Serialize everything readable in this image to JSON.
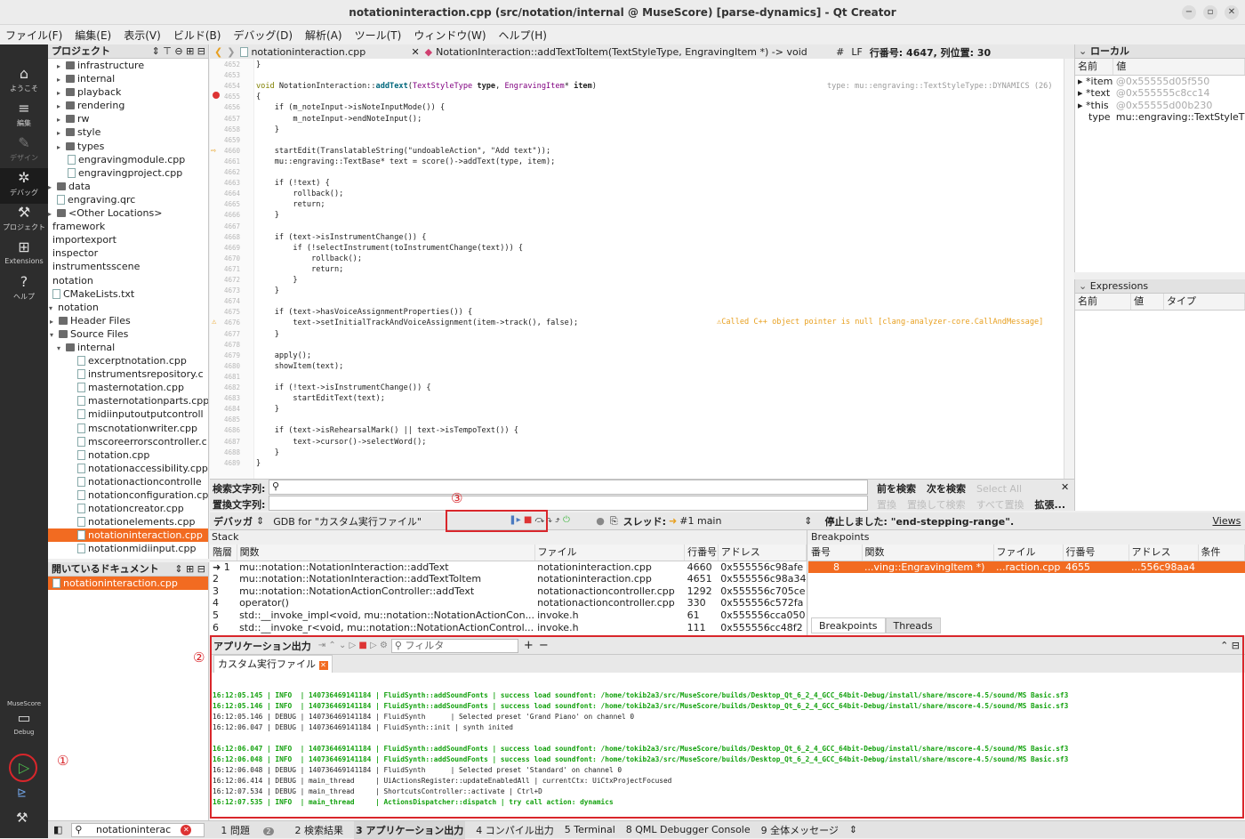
{
  "window": {
    "title": "notationinteraction.cpp (src/notation/internal @ MuseScore) [parse-dynamics] - Qt Creator"
  },
  "menu": [
    "ファイル(F)",
    "編集(E)",
    "表示(V)",
    "ビルド(B)",
    "デバッグ(D)",
    "解析(A)",
    "ツール(T)",
    "ウィンドウ(W)",
    "ヘルプ(H)"
  ],
  "modes": [
    {
      "label": "ようこそ",
      "icon": "home-icon"
    },
    {
      "label": "編集",
      "icon": "edit-icon"
    },
    {
      "label": "デザイン",
      "icon": "design-icon"
    },
    {
      "label": "デバッグ",
      "icon": "bug-icon"
    },
    {
      "label": "プロジェクト",
      "icon": "wrench-icon"
    },
    {
      "label": "Extensions",
      "icon": "extensions-icon"
    },
    {
      "label": "ヘルプ",
      "icon": "help-icon"
    }
  ],
  "kit": {
    "project": "MuseScore",
    "config": "Debug"
  },
  "project_panel": {
    "title": "プロジェクト",
    "items": [
      "infrastructure",
      "internal",
      "playback",
      "rendering",
      "rw",
      "style",
      "types",
      "engravingmodule.cpp",
      "engravingproject.cpp",
      "data",
      "engraving.qrc",
      "<Other Locations>",
      "framework",
      "importexport",
      "inspector",
      "instrumentsscene",
      "notation",
      "CMakeLists.txt",
      "notation",
      "Header Files",
      "Source Files",
      "internal",
      "excerptnotation.cpp",
      "instrumentsrepository.c",
      "masternotation.cpp",
      "masternotationparts.cpp",
      "midiinputoutputcontroll",
      "mscnotationwriter.cpp",
      "mscoreerrorscontroller.c",
      "notation.cpp",
      "notationaccessibility.cpp",
      "notationactioncontrolle",
      "notationconfiguration.cp",
      "notationcreator.cpp",
      "notationelements.cpp",
      "notationinteraction.cpp",
      "notationmidiinput.cpp"
    ]
  },
  "open_docs": {
    "title": "開いているドキュメント",
    "items": [
      "notationinteraction.cpp"
    ]
  },
  "editor": {
    "file_tab": "notationinteraction.cpp",
    "function": "NotationInteraction::addTextToItem(TextStyleType, EngravingItem *) -> void",
    "hash": "#",
    "eol": "LF",
    "line_info": "行番号: 4647, 列位置: 30",
    "first_line": 4652,
    "type_hint": "type: mu::engraving::TextStyleType::DYNAMICS (26)",
    "warning": "Called C++ object pointer is null [clang-analyzer-core.CallAndMessage]"
  },
  "find": {
    "find_label": "検索文字列:",
    "replace_label": "置換文字列:",
    "find_prev": "前を検索",
    "find_next": "次を検索",
    "select_all": "Select All",
    "replace": "置換",
    "replace_find": "置換して検索",
    "replace_all": "すべて置換",
    "advanced": "拡張..."
  },
  "debug_toolbar": {
    "label": "デバッガ",
    "engine": "GDB for \"カスタム実行ファイル\"",
    "thread_label": "スレッド:",
    "thread": "#1 main",
    "stopped": "停止しました: \"end-stepping-range\".",
    "views": "Views"
  },
  "stack": {
    "title": "Stack",
    "headers": [
      "階層",
      "関数",
      "ファイル",
      "行番号",
      "アドレス"
    ],
    "rows": [
      [
        "1",
        "mu::notation::NotationInteraction::addText",
        "notationinteraction.cpp",
        "4660",
        "0x555556c98afe"
      ],
      [
        "2",
        "mu::notation::NotationInteraction::addTextToItem",
        "notationinteraction.cpp",
        "4651",
        "0x555556c98a34"
      ],
      [
        "3",
        "mu::notation::NotationActionController::addText",
        "notationactioncontroller.cpp",
        "1292",
        "0x555556c705ce"
      ],
      [
        "4",
        "operator()",
        "notationactioncontroller.cpp",
        "330",
        "0x555556c572fa"
      ],
      [
        "5",
        "std::__invoke_impl<void, mu::notation::NotationActionCon...",
        "invoke.h",
        "61",
        "0x555556cca050"
      ],
      [
        "6",
        "std::__invoke_r<void, mu::notation::NotationActionControl...",
        "invoke.h",
        "111",
        "0x555556cc48f2"
      ]
    ]
  },
  "breakpoints": {
    "title": "Breakpoints",
    "headers": [
      "番号",
      "関数",
      "ファイル",
      "行番号",
      "アドレス",
      "条件"
    ],
    "rows": [
      [
        "8",
        "...ving::EngravingItem *)",
        "...raction.cpp",
        "4655",
        "...556c98aa4",
        ""
      ]
    ],
    "tabs": [
      "Breakpoints",
      "Threads"
    ]
  },
  "locals": {
    "title": "ローカル",
    "headers": [
      "名前",
      "値"
    ],
    "rows": [
      [
        "*item",
        "@0x55555d05f550"
      ],
      [
        "*text",
        "@0x555555c8cc14"
      ],
      [
        "*this",
        "@0x55555d00b230"
      ],
      [
        "type",
        "mu::engraving::TextStyleT"
      ]
    ]
  },
  "expressions": {
    "title": "Expressions",
    "headers": [
      "名前",
      "値",
      "タイプ"
    ]
  },
  "app_output": {
    "title": "アプリケーション出力",
    "filter_placeholder": "フィルタ",
    "tab": "カスタム実行ファイル",
    "lines": [
      {
        "t": "",
        "g": false
      },
      {
        "t": "16:12:05.145 | INFO  | 140736469141184 | FluidSynth::addSoundFonts | success load soundfont: /home/tokib2a3/src/MuseScore/builds/Desktop_Qt_6_2_4_GCC_64bit-Debug/install/share/mscore-4.5/sound/MS Basic.sf3",
        "g": true
      },
      {
        "t": "16:12:05.146 | INFO  | 140736469141184 | FluidSynth::addSoundFonts | success load soundfont: /home/tokib2a3/src/MuseScore/builds/Desktop_Qt_6_2_4_GCC_64bit-Debug/install/share/mscore-4.5/sound/MS Basic.sf3",
        "g": true
      },
      {
        "t": "16:12:05.146 | DEBUG | 140736469141184 | FluidSynth      | Selected preset 'Grand Piano' on channel 0",
        "g": false
      },
      {
        "t": "16:12:06.047 | DEBUG | 140736469141184 | FluidSynth::init | synth inited",
        "g": false
      },
      {
        "t": "",
        "g": false
      },
      {
        "t": "16:12:06.047 | INFO  | 140736469141184 | FluidSynth::addSoundFonts | success load soundfont: /home/tokib2a3/src/MuseScore/builds/Desktop_Qt_6_2_4_GCC_64bit-Debug/install/share/mscore-4.5/sound/MS Basic.sf3",
        "g": true
      },
      {
        "t": "16:12:06.048 | INFO  | 140736469141184 | FluidSynth::addSoundFonts | success load soundfont: /home/tokib2a3/src/MuseScore/builds/Desktop_Qt_6_2_4_GCC_64bit-Debug/install/share/mscore-4.5/sound/MS Basic.sf3",
        "g": true
      },
      {
        "t": "16:12:06.048 | DEBUG | 140736469141184 | FluidSynth      | Selected preset 'Standard' on channel 0",
        "g": false
      },
      {
        "t": "16:12:06.414 | DEBUG | main_thread     | UiActionsRegister::updateEnabledAll | currentCtx: UiCtxProjectFocused",
        "g": false
      },
      {
        "t": "16:12:07.534 | DEBUG | main_thread     | ShortcutsController::activate | Ctrl+D",
        "g": false
      },
      {
        "t": "16:12:07.535 | INFO  | main_thread     | ActionsDispatcher::dispatch | try call action: dynamics",
        "g": true
      }
    ]
  },
  "bottom_tabs": [
    "1 問題",
    "2 検索結果",
    "3 アプリケーション出力",
    "4 コンパイル出力",
    "5 Terminal",
    "8 QML Debugger Console",
    "9 全体メッセージ"
  ],
  "problems_badge": "2",
  "locator": {
    "value": "notationinterac"
  },
  "annotations": [
    "①",
    "②",
    "③"
  ],
  "colors": {
    "accent": "#f26b21",
    "annotation": "#d9262b",
    "info_green": "#13a10e"
  }
}
